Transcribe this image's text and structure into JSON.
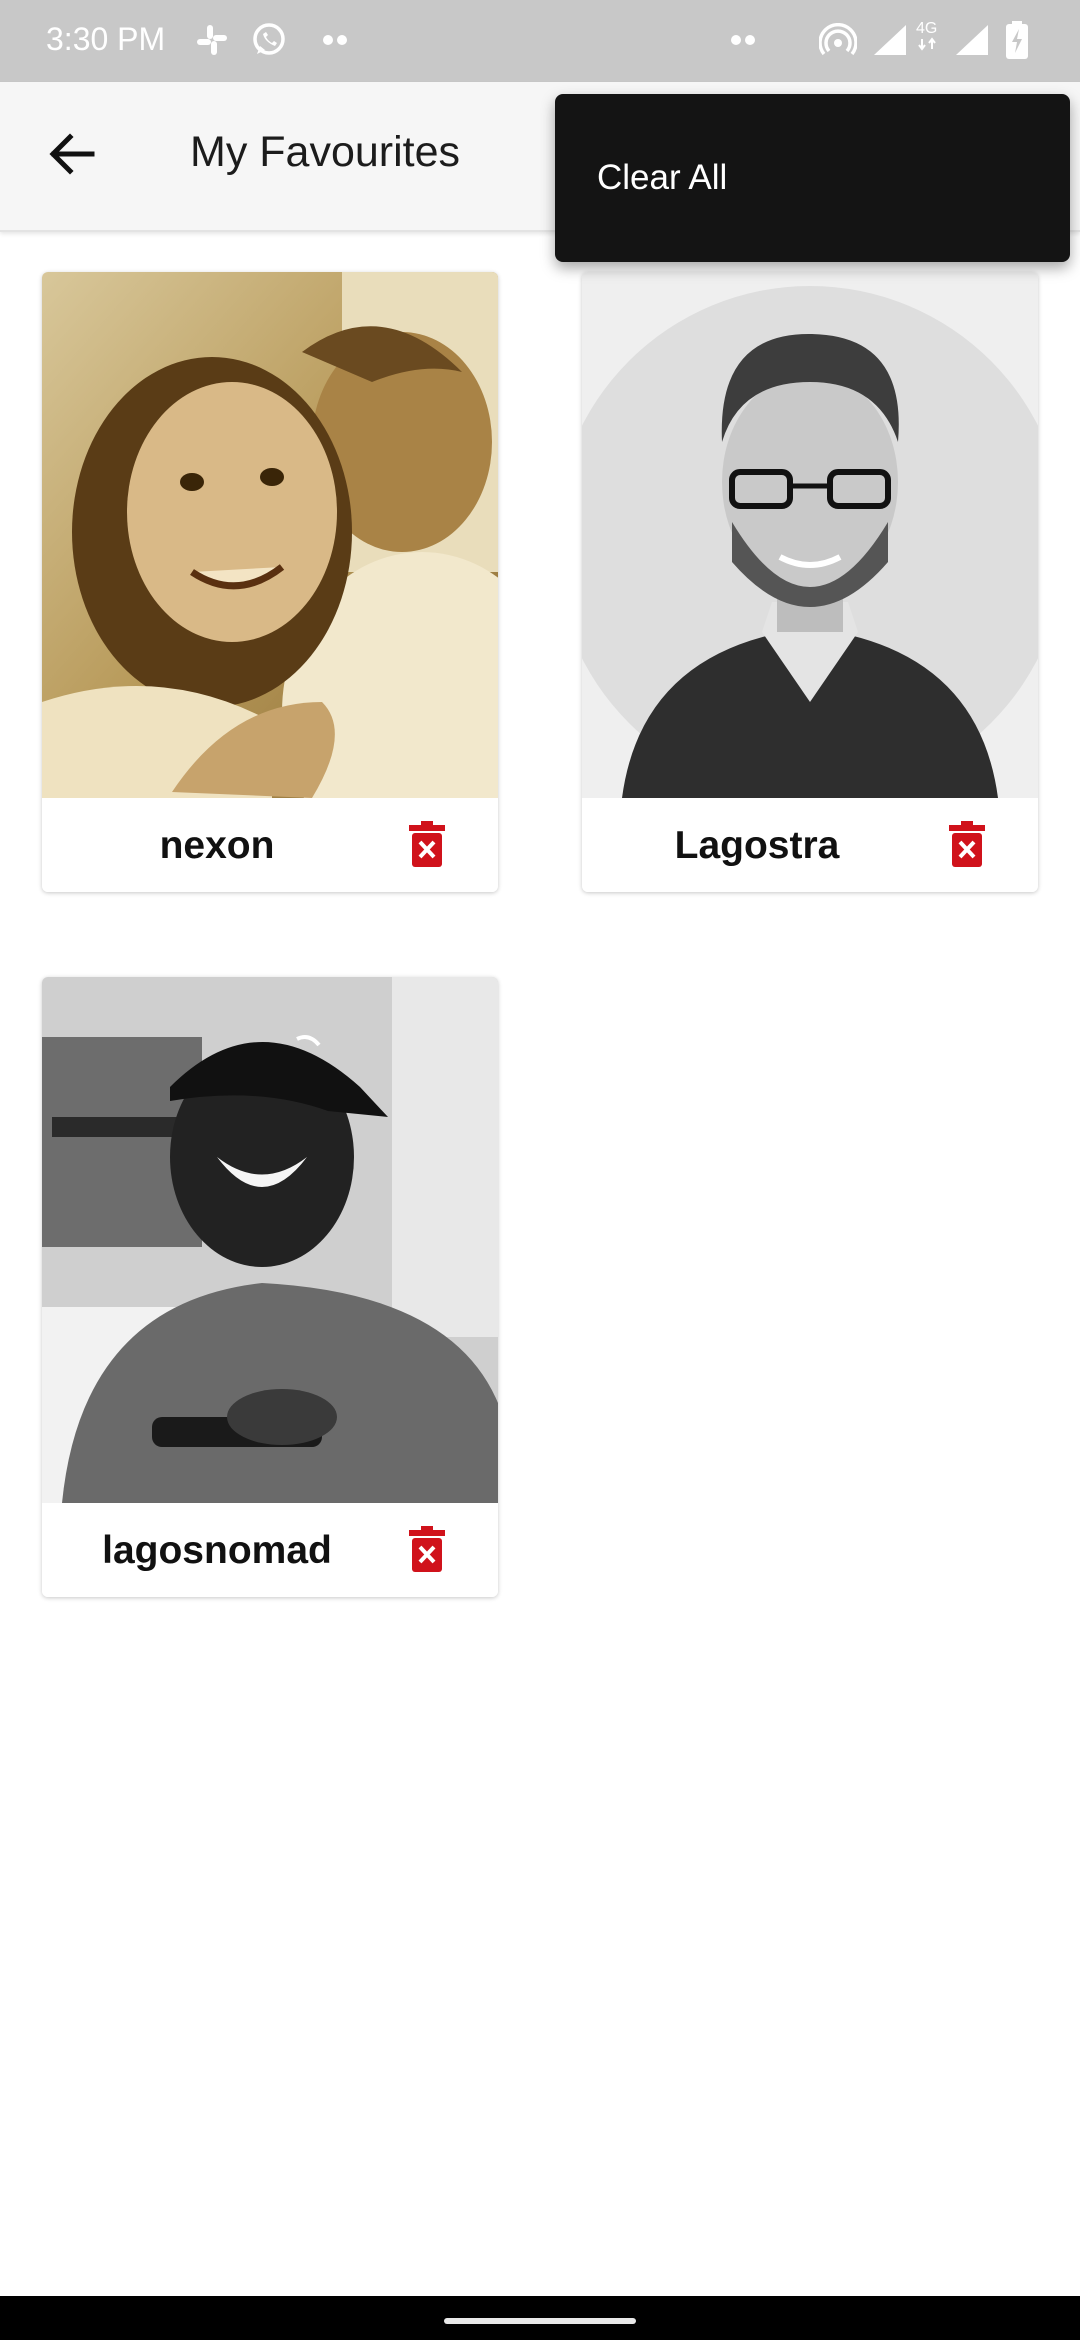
{
  "status_bar": {
    "time": "3:30 PM",
    "left_icons": [
      "slack-icon",
      "whatsapp-icon",
      "more-notifications-icon"
    ],
    "right_icons": [
      "more-notifications-icon",
      "hotspot-icon",
      "signal-icon",
      "4g-signal-icon",
      "battery-charging-icon"
    ],
    "network_label": "4G"
  },
  "app_bar": {
    "back_icon": "arrow-left-icon",
    "title": "My Favourites"
  },
  "menu": {
    "items": [
      {
        "label": "Clear All"
      }
    ]
  },
  "favourites": [
    {
      "name": "nexon",
      "photo": "sepia photo of a child and a man",
      "delete_icon": "trash-x-icon"
    },
    {
      "name": "Lagostra",
      "photo": "grayscale portrait of a man with glasses",
      "delete_icon": "trash-x-icon"
    },
    {
      "name": "lagosnomad",
      "photo": "grayscale photo of a man in a cap",
      "delete_icon": "trash-x-icon"
    }
  ],
  "colors": {
    "status_bar": "#c8c8c8",
    "app_bar": "#f6f6f6",
    "menu_bg": "#141414",
    "delete_red": "#d0121b",
    "nav_bar": "#000000"
  }
}
